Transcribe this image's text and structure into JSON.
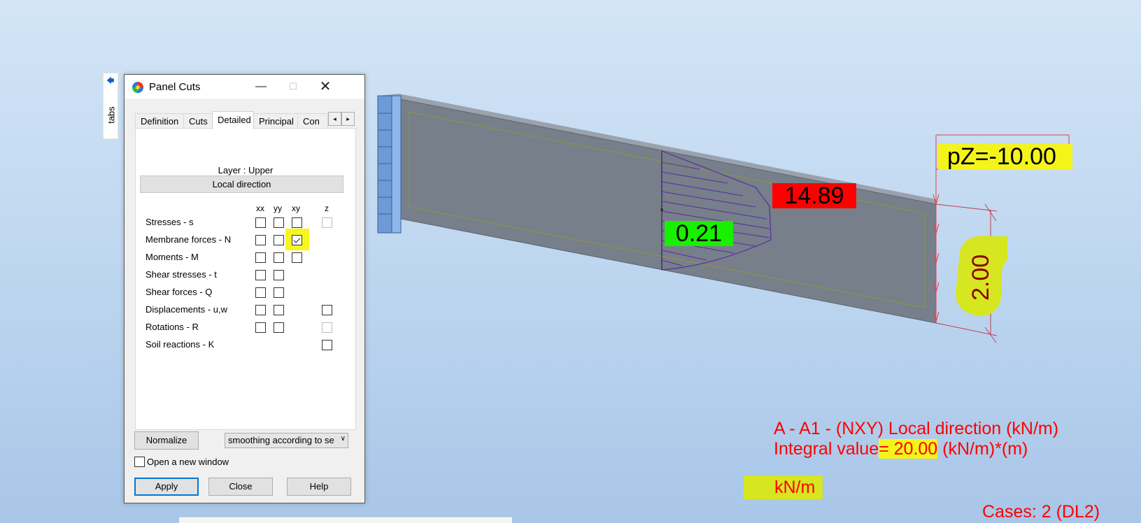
{
  "window": {
    "title": "Panel Cuts",
    "minimize_glyph": "—",
    "maximize_glyph": "☐",
    "close_glyph": "✕"
  },
  "side_tabs": {
    "label": "tabs",
    "arrow": "🡄"
  },
  "tabs": [
    {
      "label": "Definition",
      "active": false
    },
    {
      "label": "Cuts",
      "active": false
    },
    {
      "label": "Detailed",
      "active": true
    },
    {
      "label": "Principal",
      "active": false
    },
    {
      "label": "Con",
      "active": false
    }
  ],
  "tab_scroll": {
    "left": "◂",
    "right": "▸"
  },
  "detailed": {
    "layer_label": "Layer : Upper",
    "direction_button": "Local direction",
    "columns": [
      "xx",
      "yy",
      "xy",
      "z"
    ],
    "rows": [
      {
        "label": "Stresses - s",
        "xx": false,
        "yy": false,
        "xy": false,
        "z": false,
        "z_disabled": true
      },
      {
        "label": "Membrane forces - N",
        "xx": false,
        "yy": false,
        "xy": true,
        "highlight_xy": true
      },
      {
        "label": "Moments - M",
        "xx": false,
        "yy": false,
        "xy": false
      },
      {
        "label": "Shear stresses - t",
        "xx": false,
        "yy": false
      },
      {
        "label": "Shear forces - Q",
        "xx": false,
        "yy": false
      },
      {
        "label": "Displacements - u,w",
        "xx": false,
        "yy": false,
        "z": false
      },
      {
        "label": "Rotations - R",
        "xx": false,
        "yy": false,
        "z": false,
        "z_disabled": true
      },
      {
        "label": "Soil reactions - K",
        "z": false
      }
    ]
  },
  "controls": {
    "normalize": "Normalize",
    "smoothing_value": "smoothing according to se",
    "open_new_window": "Open a new window",
    "open_new_window_checked": false,
    "apply": "Apply",
    "close": "Close",
    "help": "Help"
  },
  "viewport": {
    "max_value": "14.89",
    "min_value": "0.21",
    "load_label": "pZ=-10.00",
    "dimension": "2.00",
    "legend_title": "A - A1 - (NXY) Local direction (kN/m)",
    "legend_integral_prefix": "Integral value",
    "legend_integral_value": "= 20.00",
    "legend_integral_suffix": "(kN/m)*(m)",
    "legend_unit": "kN/m",
    "legend_cases": "Cases: 2 (DL2)",
    "colors": {
      "max_box": "#ff0000",
      "min_box": "#19f000",
      "highlight": "#f4f41a",
      "legend_text": "#ff0000",
      "slab": "#777f8a",
      "hatch": "#5a2ca0"
    }
  }
}
